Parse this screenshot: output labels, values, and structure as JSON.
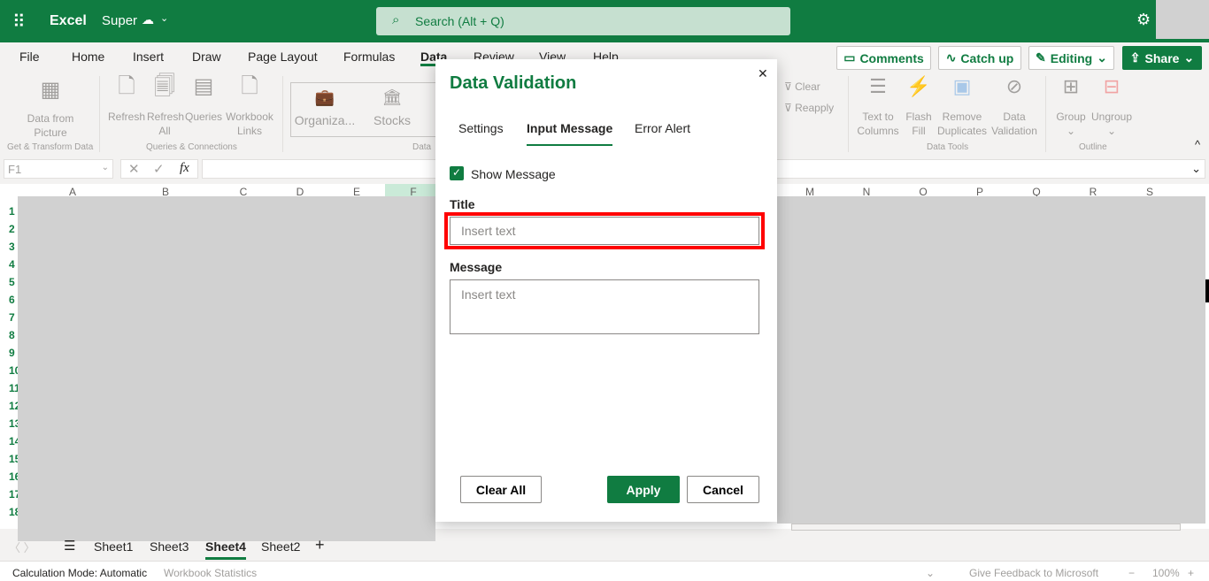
{
  "app": {
    "name": "Excel",
    "doc": "Super",
    "search_placeholder": "Search (Alt + Q)"
  },
  "menu": [
    "File",
    "Home",
    "Insert",
    "Draw",
    "Page Layout",
    "Formulas",
    "Data",
    "Review",
    "View",
    "Help"
  ],
  "actions": {
    "comments": "Comments",
    "catchup": "Catch up",
    "editing": "Editing",
    "share": "Share"
  },
  "ribbon": {
    "data_from_picture": "Data from Picture",
    "refresh": "Refresh",
    "refresh_all": "Refresh All",
    "queries": "Queries",
    "workbook_links": "Workbook Links",
    "organiza": "Organiza...",
    "stocks": "Stocks",
    "clear": "Clear",
    "reapply": "Reapply",
    "text_to_columns": "Text to Columns",
    "flash_fill": "Flash Fill",
    "remove_duplicates": "Remove Duplicates",
    "data_validation": "Data Validation",
    "group": "Group",
    "ungroup": "Ungroup",
    "groups": {
      "get_transform": "Get & Transform Data",
      "queries_conn": "Queries & Connections",
      "data_types": "Data",
      "data_tools": "Data Tools",
      "outline": "Outline"
    }
  },
  "formula_bar": {
    "name_box": "F1",
    "fx": "fx"
  },
  "columns": [
    "A",
    "B",
    "C",
    "D",
    "E",
    "F",
    "M",
    "N",
    "O",
    "P",
    "Q",
    "R",
    "S"
  ],
  "rows": [
    "1",
    "2",
    "3",
    "4",
    "5",
    "6",
    "7",
    "8",
    "9",
    "10",
    "11",
    "12",
    "13",
    "14",
    "15",
    "16",
    "17",
    "18"
  ],
  "sheets": [
    "Sheet1",
    "Sheet3",
    "Sheet4",
    "Sheet2"
  ],
  "active_sheet": "Sheet4",
  "status": {
    "calc": "Calculation Mode: Automatic",
    "stats": "Workbook Statistics",
    "feedback": "Give Feedback to Microsoft",
    "zoom": "100%"
  },
  "dialog": {
    "title": "Data Validation",
    "tabs": [
      "Settings",
      "Input Message",
      "Error Alert"
    ],
    "active_tab": "Input Message",
    "show_message": "Show Message",
    "show_message_checked": true,
    "title_label": "Title",
    "title_placeholder": "Insert text",
    "message_label": "Message",
    "message_placeholder": "Insert text",
    "clear_all": "Clear All",
    "apply": "Apply",
    "cancel": "Cancel"
  },
  "colors": {
    "brand": "#107c41",
    "highlight": "#ff0000"
  }
}
